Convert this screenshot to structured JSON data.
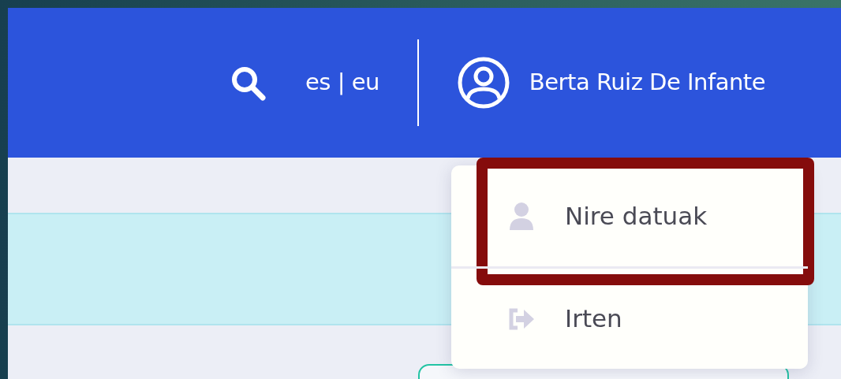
{
  "header": {
    "languages": "es | eu",
    "user_name": "Berta Ruiz De Infante"
  },
  "user_menu": {
    "items": [
      {
        "kind": "profile",
        "label": "Nire datuak",
        "highlighted": true
      },
      {
        "kind": "logout",
        "label": "Irten",
        "highlighted": false
      }
    ]
  }
}
